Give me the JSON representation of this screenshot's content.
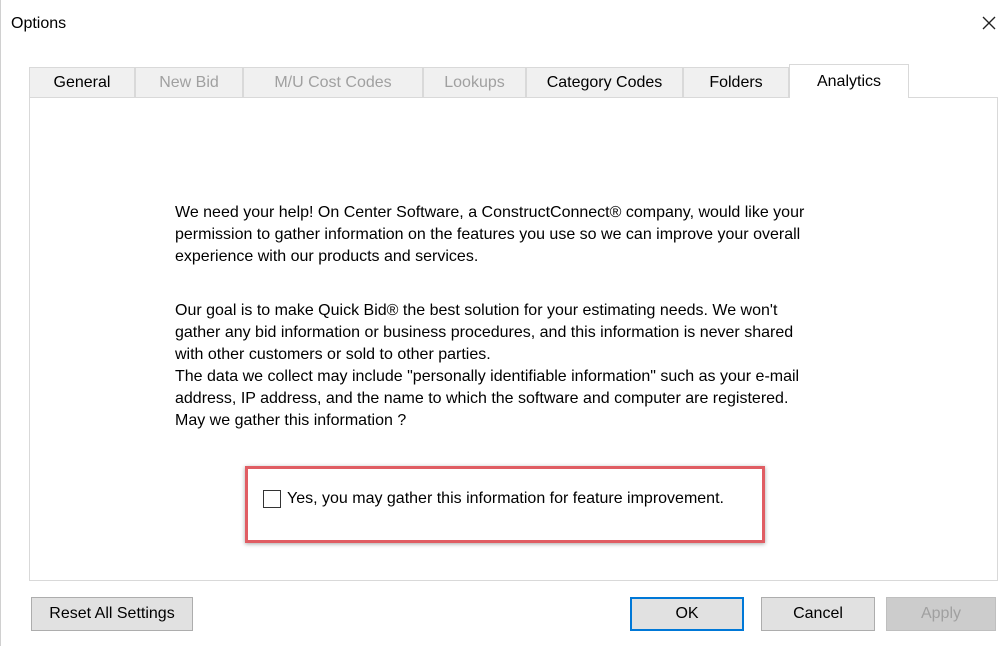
{
  "window": {
    "title": "Options"
  },
  "tabs": [
    {
      "label": "General",
      "state": "normal"
    },
    {
      "label": "New Bid",
      "state": "disabled"
    },
    {
      "label": "M/U Cost Codes",
      "state": "disabled"
    },
    {
      "label": "Lookups",
      "state": "disabled"
    },
    {
      "label": "Category Codes",
      "state": "normal"
    },
    {
      "label": "Folders",
      "state": "normal"
    },
    {
      "label": "Analytics",
      "state": "active"
    }
  ],
  "analytics": {
    "paragraph1": "We need your help! On Center Software, a ConstructConnect® company, would like your\npermission to gather information on the features you use so we can improve your overall\nexperience with our products and services.",
    "paragraph2": "Our goal is to make Quick Bid® the best solution for your estimating needs. We won't\ngather any bid information or business procedures, and this information is never shared\nwith other customers or sold to other parties.\nThe data we collect may include \"personally identifiable information\" such as your e-mail\naddress, IP address, and the name to which the software and computer are registered.\nMay we gather this information ?",
    "consent_label": "Yes, you may gather this information for feature improvement.",
    "consent_checked": false,
    "highlight_color": "#e05d63"
  },
  "buttons": {
    "reset": "Reset All Settings",
    "ok": "OK",
    "cancel": "Cancel",
    "apply": "Apply"
  },
  "icons": {
    "close": "close-icon"
  }
}
